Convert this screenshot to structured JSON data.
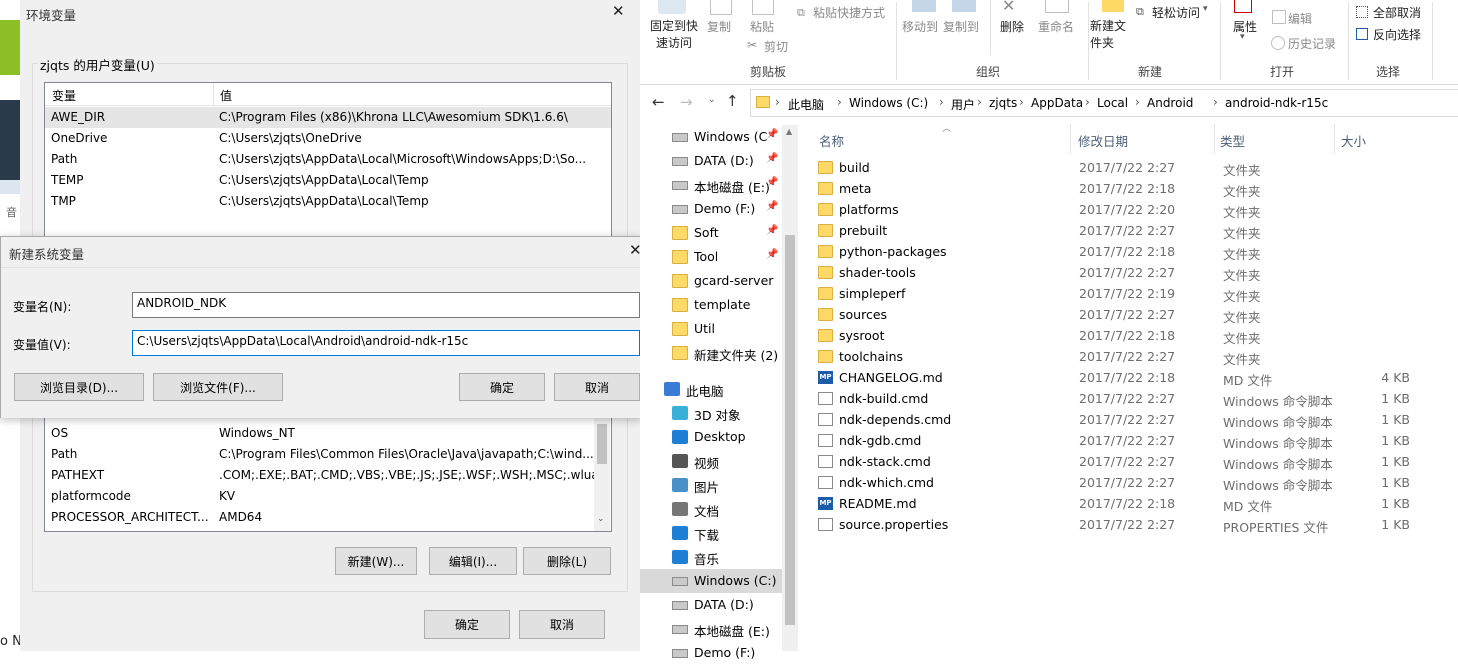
{
  "env_dialog": {
    "title": "环境变量",
    "user_group_label": "zjqts 的用户变量(U)",
    "columns": [
      "变量",
      "值"
    ],
    "user_vars": [
      {
        "name": "AWE_DIR",
        "value": "C:\\Program Files (x86)\\Khrona LLC\\Awesomium SDK\\1.6.6\\"
      },
      {
        "name": "OneDrive",
        "value": "C:\\Users\\zjqts\\OneDrive"
      },
      {
        "name": "Path",
        "value": "C:\\Users\\zjqts\\AppData\\Local\\Microsoft\\WindowsApps;D:\\So..."
      },
      {
        "name": "TEMP",
        "value": "C:\\Users\\zjqts\\AppData\\Local\\Temp"
      },
      {
        "name": "TMP",
        "value": "C:\\Users\\zjqts\\AppData\\Local\\Temp"
      }
    ],
    "system_vars": [
      {
        "name": "OS",
        "value": "Windows_NT"
      },
      {
        "name": "Path",
        "value": "C:\\Program Files\\Common Files\\Oracle\\Java\\javapath;C:\\wind..."
      },
      {
        "name": "PATHEXT",
        "value": ".COM;.EXE;.BAT;.CMD;.VBS;.VBE;.JS;.JSE;.WSF;.WSH;.MSC;.wlua..."
      },
      {
        "name": "platformcode",
        "value": "KV"
      },
      {
        "name": "PROCESSOR_ARCHITECT...",
        "value": "AMD64"
      }
    ],
    "system_buttons": {
      "new": "新建(W)...",
      "edit": "编辑(I)...",
      "delete": "删除(L)"
    },
    "ok": "确定",
    "cancel": "取消"
  },
  "new_var_dialog": {
    "title": "新建系统变量",
    "name_label": "变量名(N):",
    "name_value": "ANDROID_NDK",
    "value_label": "变量值(V):",
    "value_value": "C:\\Users\\zjqts\\AppData\\Local\\Android\\android-ndk-r15c",
    "browse_dir": "浏览目录(D)...",
    "browse_file": "浏览文件(F)...",
    "ok": "确定",
    "cancel": "取消"
  },
  "left_strip": {
    "fragment_1": "音",
    "fragment_2": "o N"
  },
  "ribbon": {
    "pin_quick": "固定到快速访问",
    "copy": "复制",
    "paste": "粘贴",
    "paste_shortcut": "粘贴快捷方式",
    "cut": "剪切",
    "move_to": "移动到",
    "copy_to": "复制到",
    "delete": "删除",
    "rename": "重命名",
    "new_folder": "新建文件夹",
    "easy_access": "轻松访问",
    "properties": "属性",
    "edit": "编辑",
    "history": "历史记录",
    "select_none": "全部取消",
    "invert_select": "反向选择",
    "groups": {
      "clipboard": "剪贴板",
      "organize": "组织",
      "new": "新建",
      "open": "打开",
      "select": "选择"
    }
  },
  "breadcrumbs": [
    "此电脑",
    "Windows (C:)",
    "用户",
    "zjqts",
    "AppData",
    "Local",
    "Android",
    "android-ndk-r15c"
  ],
  "nav": [
    {
      "label": "Windows (C",
      "icon": "drive-icon",
      "pinned": true
    },
    {
      "label": "DATA (D:)",
      "icon": "drive-icon",
      "pinned": true
    },
    {
      "label": "本地磁盘 (E:)",
      "icon": "drive-icon",
      "pinned": true
    },
    {
      "label": "Demo (F:)",
      "icon": "drive-icon",
      "pinned": true
    },
    {
      "label": "Soft",
      "icon": "folder-icon",
      "pinned": true
    },
    {
      "label": "Tool",
      "icon": "folder-icon",
      "pinned": true
    },
    {
      "label": "gcard-server",
      "icon": "folder-icon",
      "pinned": false
    },
    {
      "label": "template",
      "icon": "folder-icon",
      "pinned": false
    },
    {
      "label": "Util",
      "icon": "folder-icon",
      "pinned": false
    },
    {
      "label": "新建文件夹 (2)",
      "icon": "folder-icon",
      "pinned": false
    },
    {
      "label": "此电脑",
      "icon": "computer-icon",
      "pinned": false
    },
    {
      "label": "3D 对象",
      "icon": "3d-objects-icon",
      "pinned": false
    },
    {
      "label": "Desktop",
      "icon": "desktop-icon",
      "pinned": false
    },
    {
      "label": "视频",
      "icon": "video-icon",
      "pinned": false
    },
    {
      "label": "图片",
      "icon": "pictures-icon",
      "pinned": false
    },
    {
      "label": "文档",
      "icon": "documents-icon",
      "pinned": false
    },
    {
      "label": "下载",
      "icon": "downloads-icon",
      "pinned": false
    },
    {
      "label": "音乐",
      "icon": "music-icon",
      "pinned": false
    },
    {
      "label": "Windows (C:)",
      "icon": "drive-icon",
      "pinned": false
    },
    {
      "label": "DATA (D:)",
      "icon": "drive-icon",
      "pinned": false
    },
    {
      "label": "本地磁盘 (E:)",
      "icon": "drive-icon",
      "pinned": false
    },
    {
      "label": "Demo (F:)",
      "icon": "drive-icon",
      "pinned": false
    }
  ],
  "file_columns": {
    "name": "名称",
    "date": "修改日期",
    "type": "类型",
    "size": "大小"
  },
  "files": [
    {
      "name": "build",
      "date": "2017/7/22 2:27",
      "type": "文件夹",
      "size": "",
      "icon": "folder"
    },
    {
      "name": "meta",
      "date": "2017/7/22 2:18",
      "type": "文件夹",
      "size": "",
      "icon": "folder"
    },
    {
      "name": "platforms",
      "date": "2017/7/22 2:20",
      "type": "文件夹",
      "size": "",
      "icon": "folder"
    },
    {
      "name": "prebuilt",
      "date": "2017/7/22 2:27",
      "type": "文件夹",
      "size": "",
      "icon": "folder"
    },
    {
      "name": "python-packages",
      "date": "2017/7/22 2:18",
      "type": "文件夹",
      "size": "",
      "icon": "folder"
    },
    {
      "name": "shader-tools",
      "date": "2017/7/22 2:27",
      "type": "文件夹",
      "size": "",
      "icon": "folder"
    },
    {
      "name": "simpleperf",
      "date": "2017/7/22 2:19",
      "type": "文件夹",
      "size": "",
      "icon": "folder"
    },
    {
      "name": "sources",
      "date": "2017/7/22 2:27",
      "type": "文件夹",
      "size": "",
      "icon": "folder"
    },
    {
      "name": "sysroot",
      "date": "2017/7/22 2:18",
      "type": "文件夹",
      "size": "",
      "icon": "folder"
    },
    {
      "name": "toolchains",
      "date": "2017/7/22 2:27",
      "type": "文件夹",
      "size": "",
      "icon": "folder"
    },
    {
      "name": "CHANGELOG.md",
      "date": "2017/7/22 2:18",
      "type": "MD 文件",
      "size": "4 KB",
      "icon": "md"
    },
    {
      "name": "ndk-build.cmd",
      "date": "2017/7/22 2:27",
      "type": "Windows 命令脚本",
      "size": "1 KB",
      "icon": "cmd"
    },
    {
      "name": "ndk-depends.cmd",
      "date": "2017/7/22 2:27",
      "type": "Windows 命令脚本",
      "size": "1 KB",
      "icon": "cmd"
    },
    {
      "name": "ndk-gdb.cmd",
      "date": "2017/7/22 2:27",
      "type": "Windows 命令脚本",
      "size": "1 KB",
      "icon": "cmd"
    },
    {
      "name": "ndk-stack.cmd",
      "date": "2017/7/22 2:27",
      "type": "Windows 命令脚本",
      "size": "1 KB",
      "icon": "cmd"
    },
    {
      "name": "ndk-which.cmd",
      "date": "2017/7/22 2:27",
      "type": "Windows 命令脚本",
      "size": "1 KB",
      "icon": "cmd"
    },
    {
      "name": "README.md",
      "date": "2017/7/22 2:18",
      "type": "MD 文件",
      "size": "1 KB",
      "icon": "md"
    },
    {
      "name": "source.properties",
      "date": "2017/7/22 2:27",
      "type": "PROPERTIES 文件",
      "size": "1 KB",
      "icon": "doc"
    }
  ],
  "md_icon_text": "MP"
}
